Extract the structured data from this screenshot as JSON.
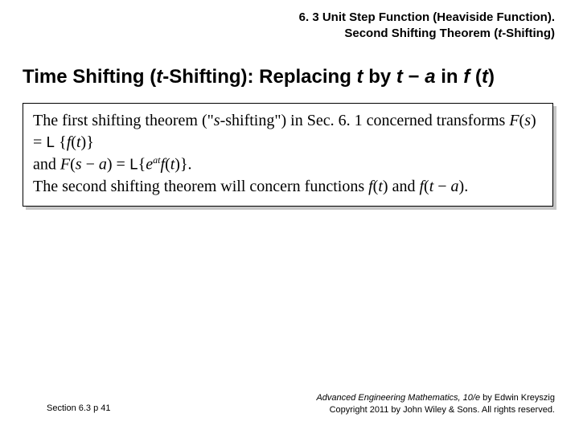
{
  "header": {
    "line1": "6. 3 Unit Step Function (Heaviside Function).",
    "line2_prefix": "Second Shifting Theorem (",
    "line2_ital": "t",
    "line2_suffix": "-Shifting)"
  },
  "title": {
    "t1": "Time Shifting (",
    "t2": "t",
    "t3": "-Shifting):  Replacing ",
    "t4": "t",
    "t5": " by ",
    "t6": "t",
    "t7": " − ",
    "t8": "a",
    "t9": " in ",
    "t10": "f",
    "t11": " (",
    "t12": "t",
    "t13": ")"
  },
  "body": {
    "p1a": "The first shifting theorem (\"",
    "p1b": "s",
    "p1c": "-shifting\") in Sec. 6. 1 concerned transforms ",
    "p1d": "F",
    "p1e": "(",
    "p1f": "s",
    "p1g": ") = ",
    "p1h": "L",
    "p1i": " {",
    "p1j": "f",
    "p1k": "(",
    "p1l": "t",
    "p1m": ")}",
    "p2a": "and ",
    "p2b": "F",
    "p2c": "(",
    "p2d": "s",
    "p2e": " − ",
    "p2f": "a",
    "p2g": ") = ",
    "p2h": "L",
    "p2i": "{",
    "p2j": "e",
    "p2k": "at",
    "p2l": "f",
    "p2m": "(",
    "p2n": "t",
    "p2o": ")}.",
    "p3a": "The second shifting theorem will concern functions ",
    "p3b": "f",
    "p3c": "(",
    "p3d": "t",
    "p3e": ") and ",
    "p3f": "f",
    "p3g": "(",
    "p3h": "t",
    "p3i": " − ",
    "p3j": "a",
    "p3k": ")."
  },
  "footer": {
    "left": "Section 6.3  p 41",
    "book": "Advanced Engineering Mathematics, 10/e",
    "author": " by Edwin Kreyszig",
    "copyright": "Copyright 2011 by John Wiley & Sons.  All rights reserved."
  }
}
